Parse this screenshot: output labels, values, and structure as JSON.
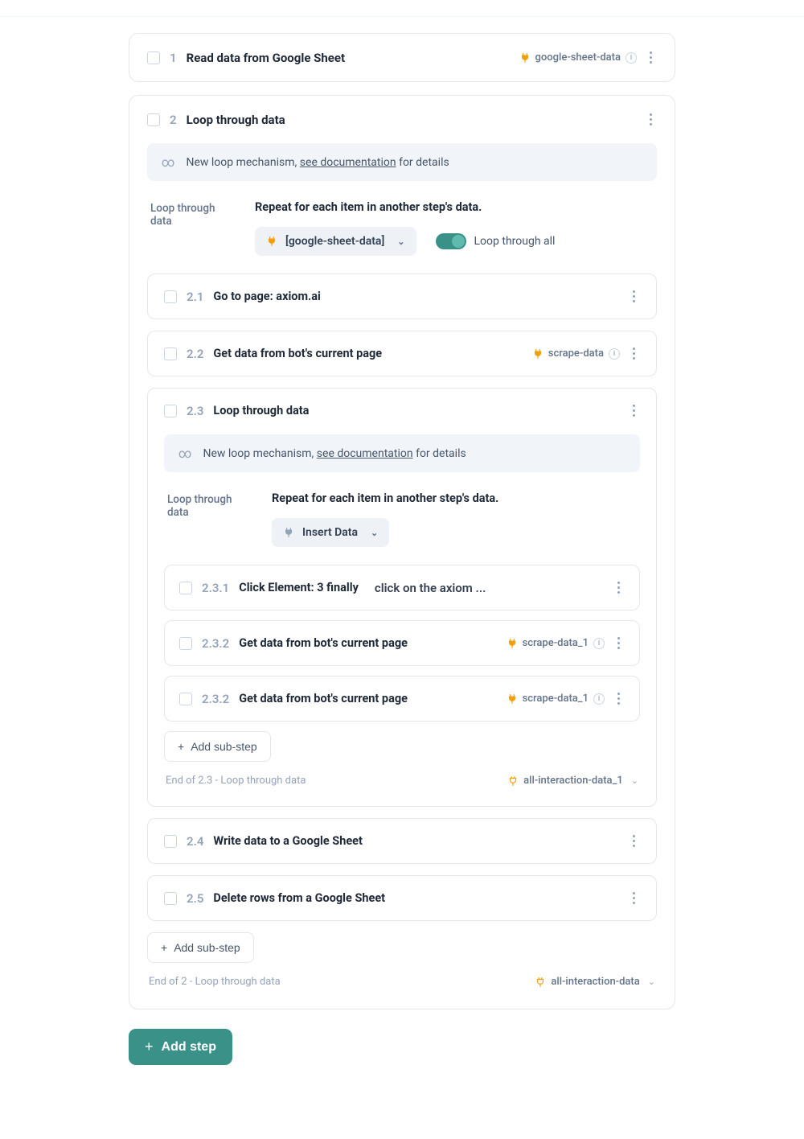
{
  "steps": {
    "s1": {
      "num": "1",
      "title": "Read data from Google Sheet",
      "tag": "google-sheet-data"
    },
    "s2": {
      "num": "2",
      "title": "Loop through data",
      "banner_prefix": "New loop mechanism, ",
      "banner_link": "see documentation",
      "banner_suffix": " for details",
      "config_label": "Loop through data",
      "config_heading": "Repeat for each item in another step's data.",
      "dropdown": "[google-sheet-data]",
      "toggle_label": "Loop through all",
      "substeps": {
        "s21": {
          "num": "2.1",
          "title": "Go to page: axiom.ai"
        },
        "s22": {
          "num": "2.2",
          "title": "Get data from bot's current page",
          "tag": "scrape-data"
        },
        "s23": {
          "num": "2.3",
          "title": "Loop through data",
          "banner_prefix": "New loop mechanism, ",
          "banner_link": "see documentation",
          "banner_suffix": " for details",
          "config_label": "Loop through data",
          "config_heading": "Repeat for each item in another step's data.",
          "dropdown": "Insert Data",
          "inner": {
            "i1": {
              "num": "2.3.1",
              "title": "Click Element: 3 finally",
              "extra": "click on the axiom ..."
            },
            "i2": {
              "num": "2.3.2",
              "title": "Get data from bot's current page",
              "tag": "scrape-data_1"
            },
            "i3": {
              "num": "2.3.2",
              "title": "Get data from bot's current page",
              "tag": "scrape-data_1"
            }
          },
          "add_sub": "Add sub-step",
          "footer_left": "End of 2.3 - Loop through data",
          "footer_tag": "all-interaction-data_1"
        },
        "s24": {
          "num": "2.4",
          "title": "Write data to a Google Sheet"
        },
        "s25": {
          "num": "2.5",
          "title": "Delete rows from a Google Sheet"
        }
      },
      "add_sub": "Add sub-step",
      "footer_left": "End of 2 - Loop through data",
      "footer_tag": "all-interaction-data"
    }
  },
  "add_step": "Add step"
}
